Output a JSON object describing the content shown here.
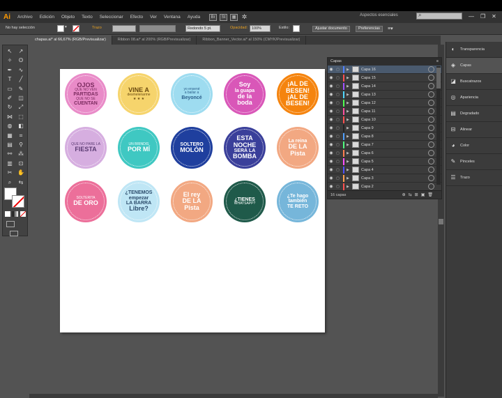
{
  "app": {
    "logo": "Ai"
  },
  "menu": [
    "Archivo",
    "Edición",
    "Objeto",
    "Texto",
    "Seleccionar",
    "Efecto",
    "Ver",
    "Ventana",
    "Ayuda"
  ],
  "menu_icons": [
    "bridge-icon",
    "stock-icon",
    "arrange-documents-icon",
    "gpu-icon"
  ],
  "workspace": "Aspectos esenciales",
  "search": {
    "placeholder": ""
  },
  "window_buttons": [
    "—",
    "❐",
    "✕"
  ],
  "control": {
    "selection": "No hay selección",
    "stroke_label": "Trazo",
    "brush": "Redondo 5 pt.",
    "opacity_label": "Opacidad:",
    "opacity_value": "100%",
    "style_label": "Estilo:",
    "doc_settings": "Ajustar documento",
    "prefs": "Preferencias"
  },
  "tabs": [
    "chapas.ai* al 66,67% (RGB/Previsualizar)",
    "Ribbon 08.ai* al 200% (RGB/Previsualizar)",
    "Ribbon_Banner_Vector.ai* al 150% (CMYK/Previsualizar)"
  ],
  "badges": [
    {
      "lines": [
        "OJOS",
        "QUE NO VEN",
        "PARTIDAS",
        "QUE NO SE",
        "CUENTAN"
      ],
      "bg": "#e98bc8",
      "fg": "#7a2a5e"
    },
    {
      "lines": [
        "VINE A",
        "desmelenarme",
        "★ ★ ★"
      ],
      "bg": "#f6d46c",
      "fg": "#6b4a10"
    },
    {
      "lines": [
        "yo ensené",
        "a bailar a",
        "Beyoncé"
      ],
      "bg": "#9edcf0",
      "fg": "#2a5e8a"
    },
    {
      "lines": [
        "Soy",
        "la guapa",
        "de la",
        "boda"
      ],
      "bg": "#d957b8",
      "fg": "#ffffff"
    },
    {
      "lines": [
        "¡AL DE",
        "BESEN!",
        "¡AL DE",
        "BESEN!"
      ],
      "bg": "#f5840e",
      "fg": "#ffffff"
    },
    {
      "lines": [
        "QUE NO PARE LA",
        "FIESTA"
      ],
      "bg": "#d6aee0",
      "fg": "#5a3a72"
    },
    {
      "lines": [
        "UN BRINDIS",
        "POR MÍ"
      ],
      "bg": "#3fc8c2",
      "fg": "#ffffff"
    },
    {
      "lines": [
        "SOLTERO",
        "MOLÓN"
      ],
      "bg": "#1f3f9e",
      "fg": "#ffffff"
    },
    {
      "lines": [
        "ESTA",
        "NOCHE",
        "SERÁ LA",
        "BOMBA"
      ],
      "bg": "#3a3f9a",
      "fg": "#ffffff"
    },
    {
      "lines": [
        "La reina",
        "DE LA",
        "Pista"
      ],
      "bg": "#f2a882",
      "fg": "#ffffff"
    },
    {
      "lines": [
        "SOLTERITA",
        "DE ORO"
      ],
      "bg": "#ec6f9a",
      "fg": "#ffffff"
    },
    {
      "lines": [
        "¿TENEMOS",
        "empezar",
        "LA BARRA",
        "Libre?"
      ],
      "bg": "#bfe6f5",
      "fg": "#2a4a6a"
    },
    {
      "lines": [
        "El rey",
        "DE LA",
        "Pista"
      ],
      "bg": "#f2a882",
      "fg": "#ffffff"
    },
    {
      "lines": [
        "¿TIENES",
        "WHATSAPP?"
      ],
      "bg": "#1f5a4a",
      "fg": "#ffffff"
    },
    {
      "lines": [
        "¿Te hago",
        "también",
        "TE RETO"
      ],
      "bg": "#76b6da",
      "fg": "#ffffff"
    }
  ],
  "layers": {
    "title": "Capas",
    "count": "16 capas",
    "items": [
      {
        "name": "Capa 16",
        "color": "#4f7fff",
        "selected": true
      },
      {
        "name": "Capa 15",
        "color": "#ff4f4f"
      },
      {
        "name": "Capa 14",
        "color": "#a04fff"
      },
      {
        "name": "Capa 13",
        "color": "#4fd9ff"
      },
      {
        "name": "Capa 12",
        "color": "#4fff4f"
      },
      {
        "name": "Capa 11",
        "color": "#ff4fa0"
      },
      {
        "name": "Capa 10",
        "color": "#ff4f4f"
      },
      {
        "name": "Capa 9",
        "color": "#222222"
      },
      {
        "name": "Capa 8",
        "color": "#4fa0ff"
      },
      {
        "name": "Capa 7",
        "color": "#4fff7f"
      },
      {
        "name": "Capa 6",
        "color": "#ff7f4f"
      },
      {
        "name": "Capa 5",
        "color": "#ff4fff"
      },
      {
        "name": "Capa 4",
        "color": "#4f4fff"
      },
      {
        "name": "Capa 3",
        "color": "#ffa04f"
      },
      {
        "name": "Capa 2",
        "color": "#ff4f4f"
      }
    ]
  },
  "right_panels": [
    {
      "label": "Transparencia",
      "icon": "transparency-icon"
    },
    {
      "label": "Capas",
      "icon": "layers-icon",
      "selected": true
    },
    {
      "label": "Buscatrazos",
      "icon": "pathfinder-icon"
    },
    {
      "label": "Apariencia",
      "icon": "appearance-icon"
    },
    {
      "label": "Degradado",
      "icon": "gradient-icon"
    },
    {
      "label": "Alinear",
      "icon": "align-icon"
    },
    {
      "label": "Color",
      "icon": "color-icon"
    },
    {
      "label": "Pinceles",
      "icon": "brushes-icon"
    },
    {
      "label": "Trazo",
      "icon": "stroke-icon"
    }
  ]
}
